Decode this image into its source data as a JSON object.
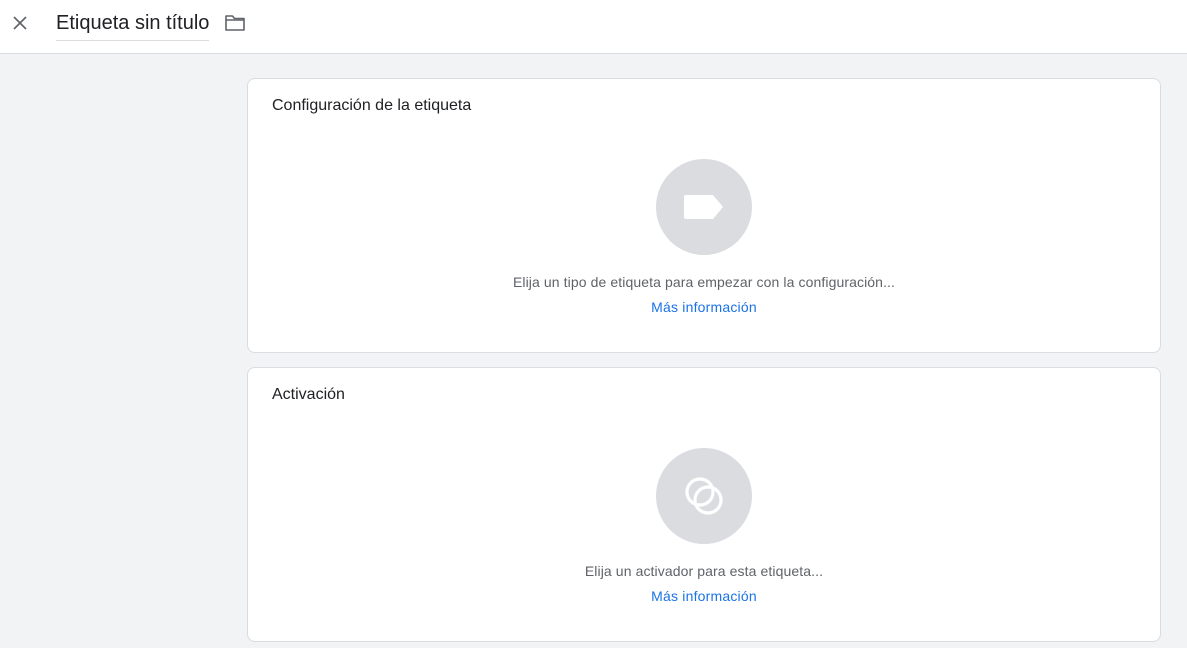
{
  "header": {
    "title": "Etiqueta sin título",
    "close_icon": "close-icon",
    "folder_icon": "folder-icon"
  },
  "cards": {
    "tag_config": {
      "title": "Configuración de la etiqueta",
      "icon": "tag-icon",
      "hint": "Elija un tipo de etiqueta para empezar con la configuración...",
      "learn_more": "Más información"
    },
    "triggering": {
      "title": "Activación",
      "icon": "trigger-icon",
      "hint": "Elija un activador para esta etiqueta...",
      "learn_more": "Más información"
    }
  },
  "colors": {
    "background": "#f1f3f4",
    "card": "#ffffff",
    "border": "#dadce0",
    "icon_circle": "#dadce0",
    "link": "#1a73e8",
    "hint_text": "#5f6368",
    "title_text": "#202124"
  }
}
